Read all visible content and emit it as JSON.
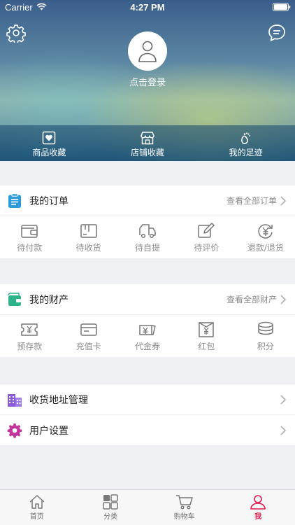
{
  "status_bar": {
    "carrier": "Carrier",
    "time": "4:27 PM"
  },
  "header": {
    "login_text": "点击登录",
    "shortcuts": [
      {
        "label": "商品收藏",
        "icon": "heart-box-icon"
      },
      {
        "label": "店铺收藏",
        "icon": "store-icon"
      },
      {
        "label": "我的足迹",
        "icon": "footprint-icon"
      }
    ]
  },
  "orders": {
    "title": "我的订单",
    "more": "查看全部订单",
    "items": [
      {
        "label": "待付款",
        "icon": "wallet-icon"
      },
      {
        "label": "待收货",
        "icon": "package-icon"
      },
      {
        "label": "待自提",
        "icon": "truck-icon"
      },
      {
        "label": "待评价",
        "icon": "edit-icon"
      },
      {
        "label": "退款/退货",
        "icon": "refund-icon"
      }
    ]
  },
  "assets": {
    "title": "我的财产",
    "more": "查看全部财产",
    "items": [
      {
        "label": "预存款",
        "icon": "deposit-icon"
      },
      {
        "label": "充值卡",
        "icon": "card-icon"
      },
      {
        "label": "代金券",
        "icon": "voucher-icon"
      },
      {
        "label": "红包",
        "icon": "red-envelope-icon"
      },
      {
        "label": "积分",
        "icon": "coins-icon"
      }
    ]
  },
  "menu": [
    {
      "label": "收货地址管理",
      "icon": "building-icon"
    },
    {
      "label": "用户设置",
      "icon": "gear-icon"
    }
  ],
  "tabbar": [
    {
      "label": "首页",
      "icon": "home-icon"
    },
    {
      "label": "分类",
      "icon": "category-icon"
    },
    {
      "label": "购物车",
      "icon": "cart-icon"
    },
    {
      "label": "我",
      "icon": "user-icon",
      "active": true
    }
  ],
  "colors": {
    "accent": "#e2174a",
    "order_icon": "#2e9ad8",
    "asset_icon": "#2bb38a",
    "address_icon": "#8a5ad8",
    "settings_icon": "#c2359a"
  }
}
